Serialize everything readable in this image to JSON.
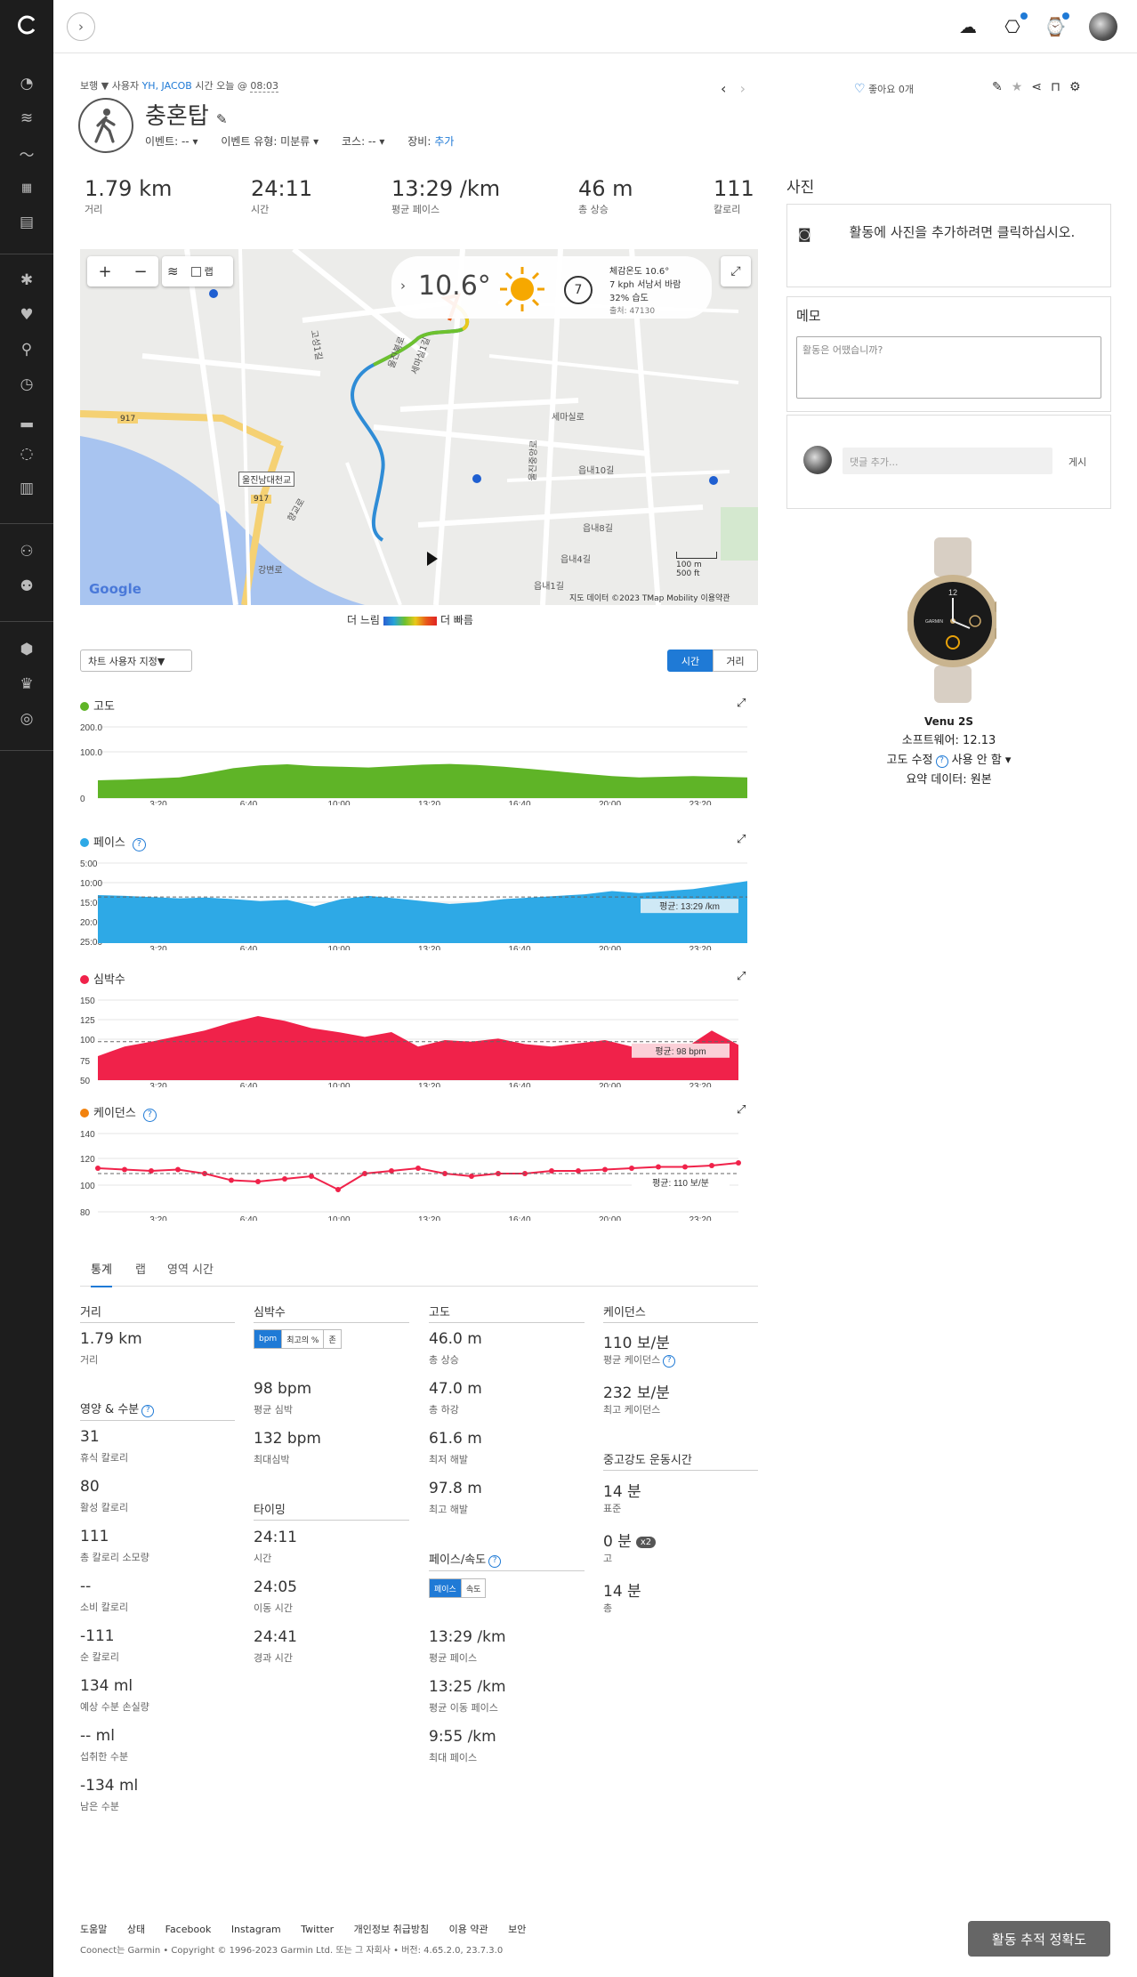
{
  "colors": {
    "accent": "#1f7ad6",
    "sidebar": "#1d1d1d",
    "elevation": "#5fb427",
    "pace": "#2ea9e6",
    "heart_rate": "#f0224a",
    "cadence": "#f2820d"
  },
  "header": {
    "breadcrumb": {
      "activity_type": "보행 ▼",
      "user_prefix": "사용자",
      "user": "YH, JACOB",
      "time_prefix": "시간 오늘 @",
      "time": "08:03"
    },
    "title": "충혼탑",
    "meta": {
      "event": "이벤트: -- ▾",
      "event_type": "이벤트 유형: 미분류 ▾",
      "course": "코스: -- ▾",
      "gear_label": "장비:",
      "gear_add": "추가"
    },
    "likes": "좋아요 0개"
  },
  "stats": [
    {
      "value": "1.79 km",
      "label": "거리"
    },
    {
      "value": "24:11",
      "label": "시간"
    },
    {
      "value": "13:29 /km",
      "label": "평균 페이스"
    },
    {
      "value": "46 m",
      "label": "총 상승"
    },
    {
      "value": "111",
      "label": "칼로리"
    }
  ],
  "map": {
    "layer_checkbox": "랩",
    "weather": {
      "temp": "10.6°",
      "wind_speed": "7",
      "feels": "체감온도 10.6°",
      "wind": "7 kph 서남서 바람",
      "humidity": "32% 습도",
      "source": "출처: 47130"
    },
    "street_labels": [
      "울진북로",
      "세마실1길",
      "고성1길",
      "세마실로",
      "읍내10길",
      "읍내8길",
      "읍내4길",
      "읍내1길",
      "울진중앙로",
      "울진남대천교",
      "강변로",
      "향교로"
    ],
    "road_badges": [
      "917",
      "917"
    ],
    "google": "Google",
    "attribution": "지도 데이터 ©2023 TMap Mobility   이용약관",
    "scale_m": "100 m",
    "scale_ft": "500 ft",
    "legend_slow": "더 느림",
    "legend_fast": "더 빠름"
  },
  "chart_controls": {
    "customize": "차트 사용자 지정▼",
    "time": "시간",
    "distance": "거리"
  },
  "chart_data": [
    {
      "type": "area",
      "title": "고도",
      "x_ticks": [
        "3:20",
        "6:40",
        "10:00",
        "13:20",
        "16:40",
        "20:00",
        "23:20"
      ],
      "y_ticks": [
        "200.0",
        "100.0",
        "0"
      ],
      "ylim": [
        0,
        200
      ],
      "series": [
        {
          "values": [
            50,
            52,
            55,
            58,
            70,
            84,
            92,
            95,
            90,
            88,
            86,
            90,
            94,
            96,
            93,
            88,
            82,
            75,
            68,
            62,
            58,
            60,
            62,
            60,
            58
          ]
        }
      ]
    },
    {
      "type": "area",
      "title": "페이스",
      "x_ticks": [
        "3:20",
        "6:40",
        "10:00",
        "13:20",
        "16:40",
        "20:00",
        "23:20"
      ],
      "y_ticks": [
        "5:00",
        "10:00",
        "15:00",
        "20:00",
        "25:00"
      ],
      "avg_label": "평균: 13:29 /km",
      "series": [
        {
          "values": [
            13.0,
            13.2,
            13.5,
            13.8,
            13.6,
            14.0,
            14.5,
            14.2,
            15.8,
            14.0,
            13.2,
            13.8,
            14.5,
            15.2,
            14.8,
            14.0,
            13.6,
            13.2,
            12.8,
            12.0,
            12.5,
            12.0,
            11.5,
            10.5,
            9.5
          ]
        }
      ]
    },
    {
      "type": "area",
      "title": "심박수",
      "x_ticks": [
        "3:20",
        "6:40",
        "10:00",
        "13:20",
        "16:40",
        "20:00",
        "23:20"
      ],
      "y_ticks": [
        "150",
        "125",
        "100",
        "75",
        "50"
      ],
      "avg_label": "평균: 98 bpm",
      "series": [
        {
          "values": [
            80,
            92,
            98,
            105,
            112,
            122,
            130,
            124,
            115,
            110,
            104,
            110,
            92,
            100,
            98,
            102,
            95,
            92,
            96,
            100,
            92,
            85,
            90,
            112,
            94
          ]
        }
      ]
    },
    {
      "type": "scatter",
      "title": "케이던스",
      "x_ticks": [
        "3:20",
        "6:40",
        "10:00",
        "13:20",
        "16:40",
        "20:00",
        "23:20"
      ],
      "y_ticks": [
        "140",
        "120",
        "100",
        "80"
      ],
      "avg_label": "평균: 110 보/분",
      "series": [
        {
          "values": [
            114,
            113,
            112,
            113,
            110,
            105,
            104,
            106,
            108,
            98,
            110,
            112,
            114,
            110,
            108,
            110,
            110,
            112,
            112,
            113,
            114,
            115,
            115,
            116,
            118
          ]
        }
      ]
    }
  ],
  "tabs": [
    "통계",
    "랩",
    "영역 시간"
  ],
  "summary": {
    "distance": {
      "header": "거리",
      "items": [
        {
          "value": "1.79 km",
          "label": "거리"
        }
      ]
    },
    "nutrition": {
      "header": "영양 & 수분",
      "items": [
        {
          "value": "31",
          "label": "휴식 칼로리"
        },
        {
          "value": "80",
          "label": "활성 칼로리"
        },
        {
          "value": "111",
          "label": "총 칼로리 소모량"
        },
        {
          "value": "--",
          "label": "소비 칼로리"
        },
        {
          "value": "-111",
          "label": "순 칼로리"
        },
        {
          "value": "134 ml",
          "label": "예상 수분 손실량"
        },
        {
          "value": "-- ml",
          "label": "섭취한 수분"
        },
        {
          "value": "-134 ml",
          "label": "남은 수분"
        }
      ]
    },
    "heart_rate": {
      "header": "심박수",
      "toggle": [
        "bpm",
        "최고의 %",
        "존"
      ],
      "items": [
        {
          "value": "98 bpm",
          "label": "평균 심박"
        },
        {
          "value": "132 bpm",
          "label": "최대심박"
        }
      ]
    },
    "timing": {
      "header": "타이밍",
      "items": [
        {
          "value": "24:11",
          "label": "시간"
        },
        {
          "value": "24:05",
          "label": "이동 시간"
        },
        {
          "value": "24:41",
          "label": "경과 시간"
        }
      ]
    },
    "elevation": {
      "header": "고도",
      "items": [
        {
          "value": "46.0 m",
          "label": "총 상승"
        },
        {
          "value": "47.0 m",
          "label": "총 하강"
        },
        {
          "value": "61.6 m",
          "label": "최저 해발"
        },
        {
          "value": "97.8 m",
          "label": "최고 해발"
        }
      ]
    },
    "pace": {
      "header": "페이스/속도",
      "toggle": [
        "페이스",
        "속도"
      ],
      "items": [
        {
          "value": "13:29 /km",
          "label": "평균 페이스"
        },
        {
          "value": "13:25 /km",
          "label": "평균 이동 페이스"
        },
        {
          "value": "9:55 /km",
          "label": "최대 페이스"
        }
      ]
    },
    "cadence": {
      "header": "케이던스",
      "items": [
        {
          "value": "110 보/분",
          "label": "평균 케이던스"
        },
        {
          "value": "232 보/분",
          "label": "최고 케이던스"
        }
      ]
    },
    "intensity": {
      "header": "중고강도 운동시간",
      "items": [
        {
          "value": "14 분",
          "label": "표준"
        },
        {
          "value": "0 분",
          "label": "고",
          "badge": "x2"
        },
        {
          "value": "14 분",
          "label": "총"
        }
      ]
    }
  },
  "right_panel": {
    "photos_header": "사진",
    "photos_prompt": "활동에 사진을 추가하려면 클릭하십시오.",
    "memo_header": "메모",
    "memo_placeholder": "활동은 어땠습니까?",
    "comment_placeholder": "댓글 추가...",
    "comment_post": "게시",
    "device": {
      "name": "Venu 2S",
      "software": "소프트웨어: 12.13",
      "elev_corr_label": "고도 수정",
      "elev_corr_value": "사용 안 함 ▾",
      "summary_data": "요약 데이터: 원본",
      "watch_time": "12",
      "watch_brand": "GARMIN"
    }
  },
  "footer": {
    "links": [
      "도움말",
      "상태",
      "Facebook",
      "Instagram",
      "Twitter",
      "개인정보 취급방침",
      "이용 약관",
      "보안"
    ],
    "copyright": "Coonect는 Garmin • Copyright © 1996-2023 Garmin Ltd. 또는 그 자회사 • 버전: 4.65.2.0, 23.7.3.0",
    "accuracy_button": "활동 추적 정확도"
  }
}
